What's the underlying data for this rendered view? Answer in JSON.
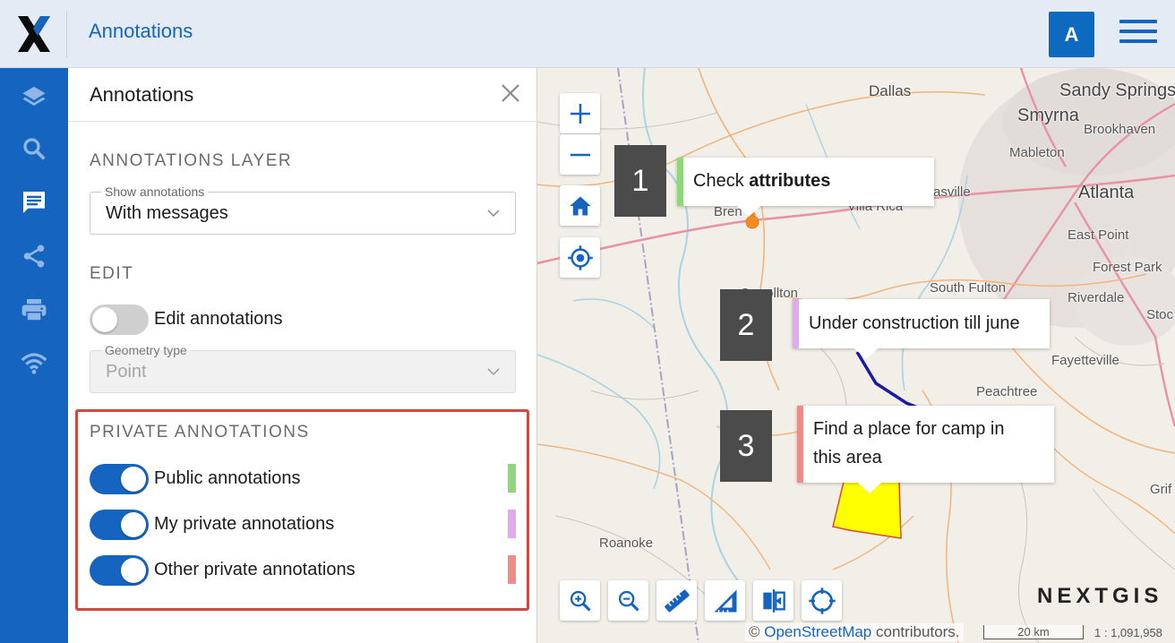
{
  "header": {
    "title": "Annotations",
    "avatar_letter": "A",
    "menu_icon": "hamburger-menu-icon",
    "logo": "nextgis-x-logo"
  },
  "iconbar": {
    "items": [
      {
        "icon": "layers-icon",
        "active": false
      },
      {
        "icon": "search-icon",
        "active": false
      },
      {
        "icon": "annotations-icon",
        "active": true
      },
      {
        "icon": "share-icon",
        "active": false
      },
      {
        "icon": "print-icon",
        "active": false
      },
      {
        "icon": "wifi-icon",
        "active": false
      }
    ]
  },
  "panel": {
    "title": "Annotations",
    "close_icon": "close-icon",
    "annotations_layer": {
      "section_title": "ANNOTATIONS LAYER",
      "show_label": "Show annotations",
      "show_value": "With messages"
    },
    "edit": {
      "section_title": "EDIT",
      "toggle_label": "Edit annotations",
      "toggle_on": false,
      "geometry_label": "Geometry type",
      "geometry_value": "Point"
    },
    "private": {
      "section_title": "PRIVATE ANNOTATIONS",
      "items": [
        {
          "label": "Public annotations",
          "on": true,
          "color": "#8fd77a"
        },
        {
          "label": "My private annotations",
          "on": true,
          "color": "#e2a8f0"
        },
        {
          "label": "Other private annotations",
          "on": true,
          "color": "#f08b86"
        }
      ]
    }
  },
  "map": {
    "controls": [
      "zoom-in-icon",
      "zoom-out-icon",
      "home-icon",
      "locate-icon"
    ],
    "tools": [
      "zoom-in-tool-icon",
      "zoom-out-tool-icon",
      "ruler-icon",
      "area-measure-icon",
      "swipe-icon",
      "identify-icon"
    ],
    "cities": [
      "Dallas",
      "Sandy Springs",
      "Smyrna",
      "Brookhaven",
      "Mableton",
      "Atlanta",
      "East Point",
      "Forest Park",
      "South Fulton",
      "Riverdale",
      "Stoc",
      "Fayetteville",
      "Peachtree",
      "Grif",
      "Carrollton",
      "Bren",
      "Roanoke",
      "asville",
      "Villa Rica"
    ],
    "callouts": [
      {
        "number": "1",
        "text_plain": "Check ",
        "text_bold": "attributes",
        "color": "#8fd77a"
      },
      {
        "number": "2",
        "text_plain": "Under construction till june",
        "text_bold": "",
        "color": "#e2a8f0"
      },
      {
        "number": "3",
        "text_line1": "Find a place for camp in",
        "text_line2": "this area",
        "color": "#f08b86"
      }
    ],
    "attribution_prefix": "© ",
    "attribution_link": "OpenStreetMap",
    "attribution_suffix": " contributors.",
    "scale_label": "20 km",
    "scale_ratio": "1 : 1,091,958",
    "brand": "NEXTGIS"
  }
}
